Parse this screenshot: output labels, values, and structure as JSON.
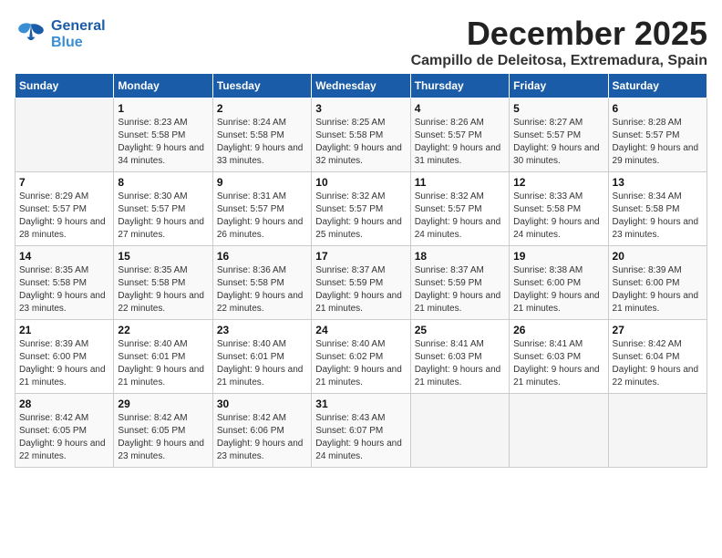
{
  "header": {
    "logo_line1": "General",
    "logo_line2": "Blue",
    "month": "December 2025",
    "location": "Campillo de Deleitosa, Extremadura, Spain"
  },
  "weekdays": [
    "Sunday",
    "Monday",
    "Tuesday",
    "Wednesday",
    "Thursday",
    "Friday",
    "Saturday"
  ],
  "weeks": [
    [
      {
        "day": "",
        "empty": true
      },
      {
        "day": "1",
        "sunrise": "8:23 AM",
        "sunset": "5:58 PM",
        "daylight": "9 hours and 34 minutes."
      },
      {
        "day": "2",
        "sunrise": "8:24 AM",
        "sunset": "5:58 PM",
        "daylight": "9 hours and 33 minutes."
      },
      {
        "day": "3",
        "sunrise": "8:25 AM",
        "sunset": "5:58 PM",
        "daylight": "9 hours and 32 minutes."
      },
      {
        "day": "4",
        "sunrise": "8:26 AM",
        "sunset": "5:57 PM",
        "daylight": "9 hours and 31 minutes."
      },
      {
        "day": "5",
        "sunrise": "8:27 AM",
        "sunset": "5:57 PM",
        "daylight": "9 hours and 30 minutes."
      },
      {
        "day": "6",
        "sunrise": "8:28 AM",
        "sunset": "5:57 PM",
        "daylight": "9 hours and 29 minutes."
      }
    ],
    [
      {
        "day": "7",
        "sunrise": "8:29 AM",
        "sunset": "5:57 PM",
        "daylight": "9 hours and 28 minutes."
      },
      {
        "day": "8",
        "sunrise": "8:30 AM",
        "sunset": "5:57 PM",
        "daylight": "9 hours and 27 minutes."
      },
      {
        "day": "9",
        "sunrise": "8:31 AM",
        "sunset": "5:57 PM",
        "daylight": "9 hours and 26 minutes."
      },
      {
        "day": "10",
        "sunrise": "8:32 AM",
        "sunset": "5:57 PM",
        "daylight": "9 hours and 25 minutes."
      },
      {
        "day": "11",
        "sunrise": "8:32 AM",
        "sunset": "5:57 PM",
        "daylight": "9 hours and 24 minutes."
      },
      {
        "day": "12",
        "sunrise": "8:33 AM",
        "sunset": "5:58 PM",
        "daylight": "9 hours and 24 minutes."
      },
      {
        "day": "13",
        "sunrise": "8:34 AM",
        "sunset": "5:58 PM",
        "daylight": "9 hours and 23 minutes."
      }
    ],
    [
      {
        "day": "14",
        "sunrise": "8:35 AM",
        "sunset": "5:58 PM",
        "daylight": "9 hours and 23 minutes."
      },
      {
        "day": "15",
        "sunrise": "8:35 AM",
        "sunset": "5:58 PM",
        "daylight": "9 hours and 22 minutes."
      },
      {
        "day": "16",
        "sunrise": "8:36 AM",
        "sunset": "5:58 PM",
        "daylight": "9 hours and 22 minutes."
      },
      {
        "day": "17",
        "sunrise": "8:37 AM",
        "sunset": "5:59 PM",
        "daylight": "9 hours and 21 minutes."
      },
      {
        "day": "18",
        "sunrise": "8:37 AM",
        "sunset": "5:59 PM",
        "daylight": "9 hours and 21 minutes."
      },
      {
        "day": "19",
        "sunrise": "8:38 AM",
        "sunset": "6:00 PM",
        "daylight": "9 hours and 21 minutes."
      },
      {
        "day": "20",
        "sunrise": "8:39 AM",
        "sunset": "6:00 PM",
        "daylight": "9 hours and 21 minutes."
      }
    ],
    [
      {
        "day": "21",
        "sunrise": "8:39 AM",
        "sunset": "6:00 PM",
        "daylight": "9 hours and 21 minutes."
      },
      {
        "day": "22",
        "sunrise": "8:40 AM",
        "sunset": "6:01 PM",
        "daylight": "9 hours and 21 minutes."
      },
      {
        "day": "23",
        "sunrise": "8:40 AM",
        "sunset": "6:01 PM",
        "daylight": "9 hours and 21 minutes."
      },
      {
        "day": "24",
        "sunrise": "8:40 AM",
        "sunset": "6:02 PM",
        "daylight": "9 hours and 21 minutes."
      },
      {
        "day": "25",
        "sunrise": "8:41 AM",
        "sunset": "6:03 PM",
        "daylight": "9 hours and 21 minutes."
      },
      {
        "day": "26",
        "sunrise": "8:41 AM",
        "sunset": "6:03 PM",
        "daylight": "9 hours and 21 minutes."
      },
      {
        "day": "27",
        "sunrise": "8:42 AM",
        "sunset": "6:04 PM",
        "daylight": "9 hours and 22 minutes."
      }
    ],
    [
      {
        "day": "28",
        "sunrise": "8:42 AM",
        "sunset": "6:05 PM",
        "daylight": "9 hours and 22 minutes."
      },
      {
        "day": "29",
        "sunrise": "8:42 AM",
        "sunset": "6:05 PM",
        "daylight": "9 hours and 23 minutes."
      },
      {
        "day": "30",
        "sunrise": "8:42 AM",
        "sunset": "6:06 PM",
        "daylight": "9 hours and 23 minutes."
      },
      {
        "day": "31",
        "sunrise": "8:43 AM",
        "sunset": "6:07 PM",
        "daylight": "9 hours and 24 minutes."
      },
      {
        "day": "",
        "empty": true
      },
      {
        "day": "",
        "empty": true
      },
      {
        "day": "",
        "empty": true
      }
    ]
  ],
  "labels": {
    "sunrise": "Sunrise:",
    "sunset": "Sunset:",
    "daylight": "Daylight:"
  }
}
